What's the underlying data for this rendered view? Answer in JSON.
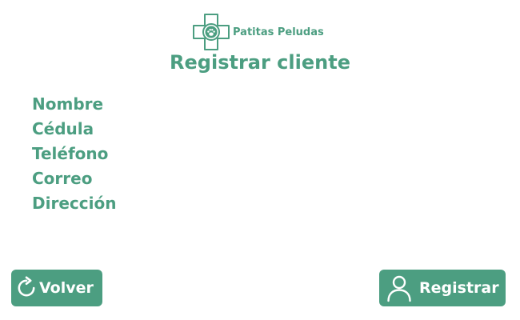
{
  "brand": {
    "name": "Patitas Peludas",
    "logo_icon": "paw-cross-icon"
  },
  "page": {
    "title": "Registrar cliente"
  },
  "form": {
    "fields": [
      {
        "label": "Nombre"
      },
      {
        "label": "Cédula"
      },
      {
        "label": "Teléfono"
      },
      {
        "label": "Correo"
      },
      {
        "label": "Dirección"
      }
    ]
  },
  "actions": {
    "back": {
      "label": "Volver",
      "icon": "refresh-icon"
    },
    "register": {
      "label": "Registrar",
      "icon": "user-icon"
    }
  },
  "colors": {
    "accent": "#4c9e81",
    "background": "#ffffff",
    "button_text": "#ffffff"
  }
}
